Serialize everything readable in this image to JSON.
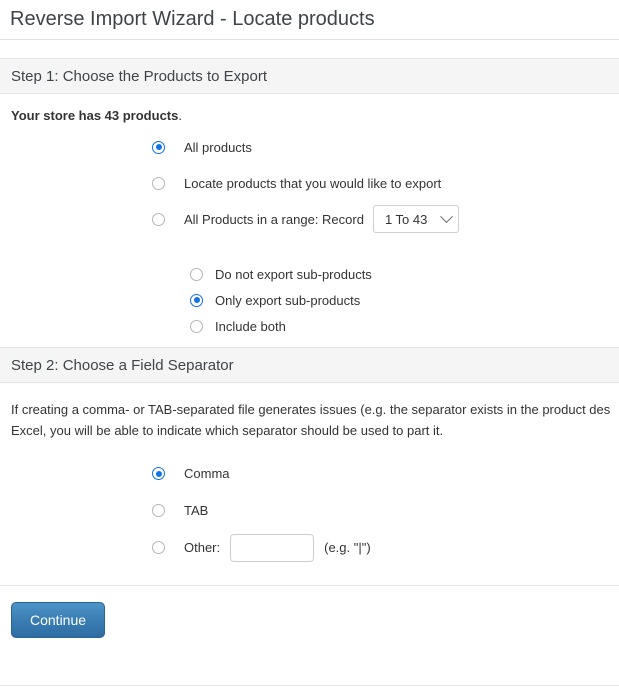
{
  "window": {
    "title": "Reverse Import Wizard - Locate products"
  },
  "step1": {
    "header": "Step 1: Choose the Products to Export",
    "store_count_bold": "Your store has 43 products",
    "store_count_tail": ".",
    "options": [
      {
        "label": "All products",
        "selected": true
      },
      {
        "label": "Locate products that you would like to export",
        "selected": false
      },
      {
        "label": "All Products in a range: Record",
        "selected": false
      }
    ],
    "range_select": {
      "value": "1 To 43",
      "options": [
        "1 To 43"
      ],
      "icon": "chevron-down-icon"
    },
    "sub_options": [
      {
        "label": "Do not export sub-products",
        "selected": false
      },
      {
        "label": "Only export sub-products",
        "selected": true
      },
      {
        "label": "Include both",
        "selected": false
      }
    ]
  },
  "step2": {
    "header": "Step 2: Choose a Field Separator",
    "intro_line1": "If creating a comma- or TAB-separated file generates issues (e.g. the separator exists in the product des",
    "intro_line2": "Excel, you will be able to indicate which separator should be used to part it.",
    "options": [
      {
        "label": "Comma",
        "selected": true
      },
      {
        "label": "TAB",
        "selected": false
      },
      {
        "label": "Other:",
        "selected": false
      }
    ],
    "other_value": "",
    "other_hint": "(e.g. \"|\")"
  },
  "footer": {
    "continue_label": "Continue"
  },
  "colors": {
    "accent": "#1273e6",
    "button": "#2e6da4",
    "band": "#f5f5f5"
  }
}
